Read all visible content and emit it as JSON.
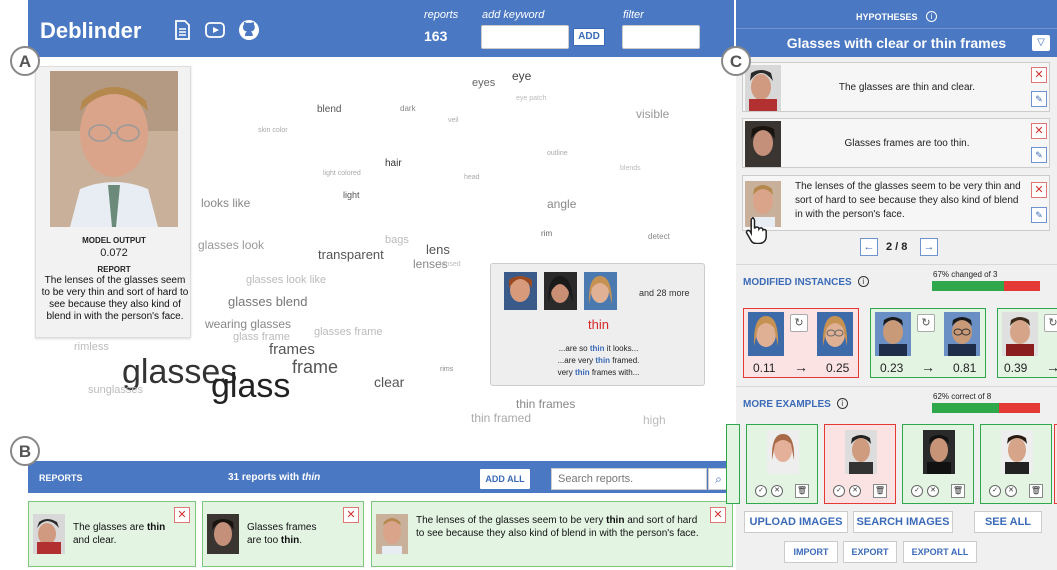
{
  "header": {
    "app_title": "Deblinder",
    "reports_label": "reports",
    "reports_count": "163",
    "keyword_label": "add keyword",
    "add_button": "ADD",
    "filter_label": "filter"
  },
  "panel_labels": {
    "a": "A",
    "b": "B",
    "c": "C"
  },
  "instance": {
    "model_output_label": "MODEL OUTPUT",
    "model_output_value": "0.072",
    "report_label": "REPORT",
    "report_text": "The lenses of the glasses seem to be very thin and sort of hard to see because they also kind of blend in with the person's face."
  },
  "word_cloud": [
    {
      "text": "eye",
      "size": 12,
      "color": "#444"
    },
    {
      "text": "eyes",
      "size": 11,
      "color": "#666"
    },
    {
      "text": "eye patch",
      "size": 7,
      "color": "#bbb"
    },
    {
      "text": "blend",
      "size": 10,
      "color": "#555"
    },
    {
      "text": "dark",
      "size": 8,
      "color": "#888"
    },
    {
      "text": "veil",
      "size": 7,
      "color": "#aaa"
    },
    {
      "text": "visible",
      "size": 12,
      "color": "#999"
    },
    {
      "text": "skin color",
      "size": 7,
      "color": "#aaa"
    },
    {
      "text": "outline",
      "size": 7,
      "color": "#aaa"
    },
    {
      "text": "hair",
      "size": 10,
      "color": "#333"
    },
    {
      "text": "light colored",
      "size": 7,
      "color": "#aaa"
    },
    {
      "text": "head",
      "size": 7,
      "color": "#aaa"
    },
    {
      "text": "blends",
      "size": 7,
      "color": "#bbb"
    },
    {
      "text": "light",
      "size": 9,
      "color": "#555"
    },
    {
      "text": "looks like",
      "size": 12,
      "color": "#888"
    },
    {
      "text": "angle",
      "size": 12,
      "color": "#888"
    },
    {
      "text": "rim",
      "size": 8,
      "color": "#666"
    },
    {
      "text": "detect",
      "size": 8,
      "color": "#888"
    },
    {
      "text": "glasses look",
      "size": 12,
      "color": "#999"
    },
    {
      "text": "bags",
      "size": 11,
      "color": "#bbb"
    },
    {
      "text": "lens",
      "size": 13,
      "color": "#555"
    },
    {
      "text": "transparent",
      "size": 13,
      "color": "#555"
    },
    {
      "text": "lenses",
      "size": 12,
      "color": "#888"
    },
    {
      "text": "lensed",
      "size": 7,
      "color": "#bbb"
    },
    {
      "text": "glasses look like",
      "size": 11,
      "color": "#bbb"
    },
    {
      "text": "glasses blend",
      "size": 13,
      "color": "#777"
    },
    {
      "text": "wearing glasses",
      "size": 12,
      "color": "#888"
    },
    {
      "text": "glass frame",
      "size": 11,
      "color": "#bbb"
    },
    {
      "text": "glasses frame",
      "size": 11,
      "color": "#bbb"
    },
    {
      "text": "rimless",
      "size": 11,
      "color": "#bbb"
    },
    {
      "text": "frames",
      "size": 15,
      "color": "#555"
    },
    {
      "text": "glasses",
      "size": 34,
      "color": "#333"
    },
    {
      "text": "frame",
      "size": 18,
      "color": "#555"
    },
    {
      "text": "glass",
      "size": 34,
      "color": "#222"
    },
    {
      "text": "clear",
      "size": 14,
      "color": "#555"
    },
    {
      "text": "rims",
      "size": 7,
      "color": "#888"
    },
    {
      "text": "sunglasses",
      "size": 11,
      "color": "#bbb"
    },
    {
      "text": "thin frames",
      "size": 12,
      "color": "#888"
    },
    {
      "text": "thin framed",
      "size": 12,
      "color": "#aaa"
    },
    {
      "text": "high",
      "size": 12,
      "color": "#bbb"
    }
  ],
  "popup": {
    "more_text": "and 28 more",
    "word": "thin",
    "snippets": [
      {
        "pre": "...are so ",
        "kw": "thin",
        "post": " it looks..."
      },
      {
        "pre": "...are very ",
        "kw": "thin",
        "post": " framed."
      },
      {
        "pre": "very ",
        "kw": "thin",
        "post": " frames with..."
      }
    ]
  },
  "reports_bar": {
    "label": "REPORTS",
    "info_prefix": "31 reports with ",
    "info_keyword": "thin",
    "add_all": "ADD ALL",
    "search_placeholder": "Search reports."
  },
  "report_cards": [
    {
      "parts": [
        "The glasses are ",
        "thin",
        " and clear."
      ]
    },
    {
      "parts": [
        "Glasses frames are too ",
        "thin",
        "."
      ]
    },
    {
      "parts": [
        "The lenses of the glasses seem to be very ",
        "thin",
        " and sort of hard to see because they also kind of blend in with the person's face."
      ]
    }
  ],
  "hypotheses": {
    "label": "HYPOTHESES",
    "title": "Glasses with clear or thin frames",
    "items": [
      {
        "text": "The glasses are thin and clear."
      },
      {
        "text": "Glasses frames are too thin."
      },
      {
        "text": "The lenses of the glasses seem to be very thin and sort of hard to see because they also kind of blend in with the person's face."
      }
    ],
    "pager": "2 / 8"
  },
  "modified": {
    "title": "MODIFIED INSTANCES",
    "bar_label": "67% changed of 3",
    "bar_fraction": 0.67,
    "items": [
      {
        "before": "0.11",
        "after": "0.25",
        "arrow": "→",
        "status": "red"
      },
      {
        "before": "0.23",
        "after": "0.81",
        "arrow": "→",
        "status": "green"
      },
      {
        "before": "0.39",
        "after": "",
        "arrow": "→",
        "status": "green"
      }
    ]
  },
  "examples": {
    "title": "MORE EXAMPLES",
    "bar_label": "62% correct of 8",
    "bar_fraction": 0.62
  },
  "actions": {
    "upload": "UPLOAD IMAGES",
    "search": "SEARCH IMAGES",
    "see_all": "SEE ALL",
    "import": "IMPORT",
    "export": "EXPORT",
    "export_all": "EXPORT ALL"
  },
  "colors": {
    "accent": "#4a78c2",
    "keyword": "#3b6bb8",
    "highlight_red": "#d62728",
    "green_border": "#2ea84a",
    "red_border": "#e53935"
  }
}
